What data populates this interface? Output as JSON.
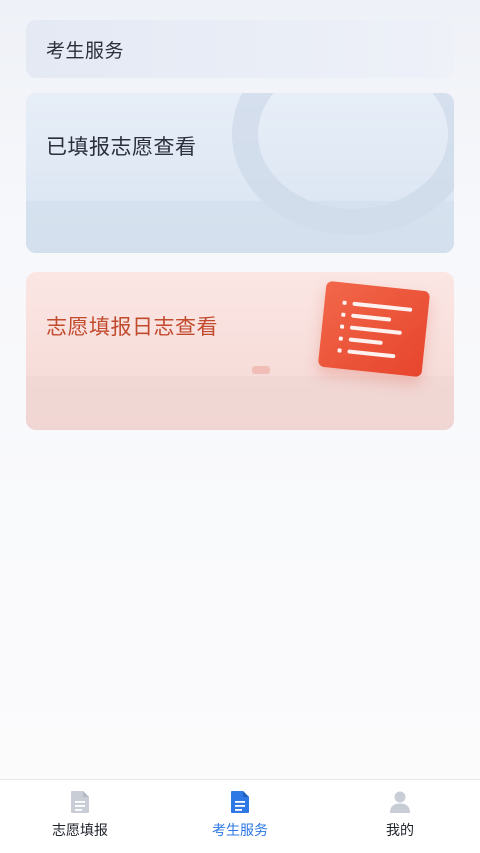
{
  "header": {
    "title": "考生服务"
  },
  "cards": {
    "view_submitted": {
      "label": "已填报志愿查看"
    },
    "view_log": {
      "label": "志愿填报日志查看"
    }
  },
  "bottom_nav": {
    "items": [
      {
        "label": "志愿填报",
        "icon": "document-icon",
        "active": false
      },
      {
        "label": "考生服务",
        "icon": "document-filled-icon",
        "active": true
      },
      {
        "label": "我的",
        "icon": "user-icon",
        "active": false
      }
    ]
  },
  "colors": {
    "accent": "#2d78e4",
    "log_title": "#c24a2d",
    "log_illustration": "#e6452c"
  }
}
